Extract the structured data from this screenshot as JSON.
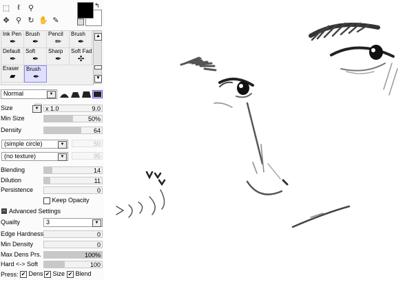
{
  "brushes": [
    {
      "label": "Ink Pen",
      "icon": "ink-pen-icon"
    },
    {
      "label": "Brush",
      "icon": "brush-icon"
    },
    {
      "label": "Pencil",
      "icon": "pencil-icon"
    },
    {
      "label": "Brush",
      "icon": "brush-icon"
    },
    {
      "label": "Default",
      "icon": "brush-icon"
    },
    {
      "label": "Soft",
      "icon": "brush-icon"
    },
    {
      "label": "Sharp",
      "icon": "brush-icon"
    },
    {
      "label": "Soft Fad",
      "icon": "fan-brush-icon"
    },
    {
      "label": "Eraser",
      "icon": "eraser-icon"
    },
    {
      "label": "Brush",
      "icon": "brush-icon",
      "selected": true
    }
  ],
  "blend_mode": "Normal",
  "size": {
    "label": "Size",
    "multiplier": "x 1.0",
    "value": "9.0"
  },
  "min_size": {
    "label": "Min Size",
    "value": "50%",
    "fraction": 0.5
  },
  "density": {
    "label": "Density",
    "value": "64",
    "fraction": 0.64
  },
  "shape_dropdown": {
    "value": "(simple circle)",
    "side_value": "50"
  },
  "texture_dropdown": {
    "value": "(no texture)",
    "side_value": "95"
  },
  "blending": {
    "label": "Blending",
    "value": "14",
    "fraction": 0.14
  },
  "dilution": {
    "label": "Dilution",
    "value": "11",
    "fraction": 0.11
  },
  "persistence": {
    "label": "Persistence",
    "value": "0",
    "fraction": 0
  },
  "keep_opacity": {
    "label": "Keep Opacity",
    "checked": false
  },
  "advanced": {
    "label": "Advanced Settings"
  },
  "quality": {
    "label": "Quailty",
    "value": "3"
  },
  "edge_hardness": {
    "label": "Edge Hardness",
    "value": "0",
    "fraction": 0
  },
  "min_density": {
    "label": "Min Density",
    "value": "0",
    "fraction": 0
  },
  "max_dens": {
    "label": "Max Dens Prs.",
    "value": "100%",
    "fraction": 1
  },
  "hard_soft": {
    "label": "Hard <-> Soft",
    "value": "100",
    "fraction": 0.36
  },
  "press": {
    "label": "Press:",
    "dens": "Dens",
    "size": "Size",
    "blend": "Blend"
  },
  "colors": {
    "foreground": "#000000",
    "background": "#ffffff",
    "selected_cell": "#dfe0ff"
  }
}
